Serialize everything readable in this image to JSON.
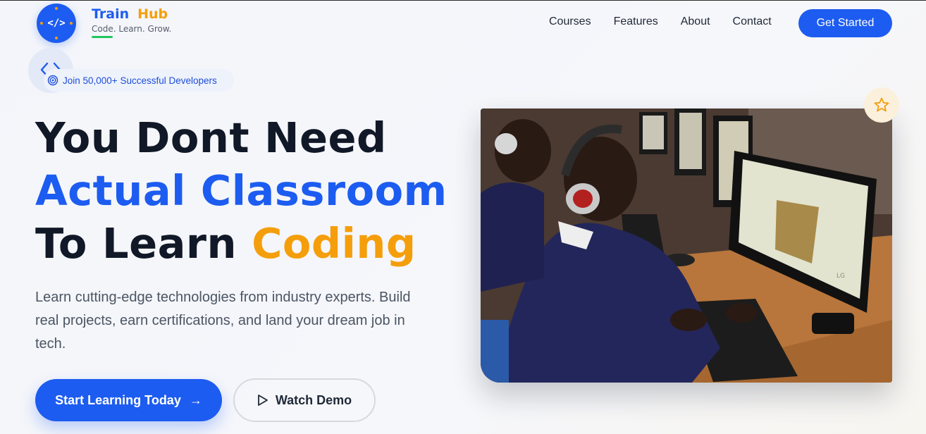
{
  "brand": {
    "logo_text": "</>",
    "word1": "Train",
    "word2": "Hub",
    "tagline": "Code. Learn. Grow."
  },
  "nav": {
    "links": [
      "Courses",
      "Features",
      "About",
      "Contact"
    ],
    "cta": "Get Started"
  },
  "badge": {
    "text": "Join 50,000+ Successful Developers",
    "icon": "target-icon"
  },
  "hero": {
    "line1": "You Dont Need",
    "line2": "Actual Classroom",
    "line3a": "To Learn",
    "line3b": "Coding",
    "lead": "Learn cutting-edge technologies from industry experts. Build real projects, earn certifications, and land your dream job in tech.",
    "primary_button": "Start Learning Today",
    "secondary_button": "Watch Demo"
  },
  "image": {
    "description_icon": "classroom-photo",
    "badge_icon": "star-icon"
  },
  "colors": {
    "primary": "#1d5cf0",
    "accent": "#f59e0b",
    "heading": "#111827",
    "body_text": "#4b5563",
    "tagline_underline": "#22c55e"
  }
}
